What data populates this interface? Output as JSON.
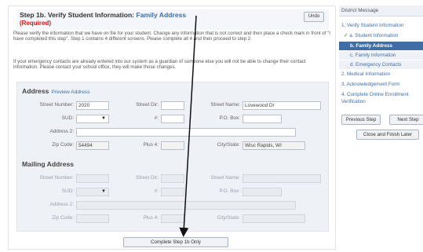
{
  "header": {
    "title_prefix": "Step 1b. Verify Student Information: ",
    "title_accent": "Family Address",
    "required": "(Required)",
    "undo_label": "Undo"
  },
  "instructions": {
    "para1": "Please verify the information that we have on file for your student. Change any information that is not correct and then place a check mark in front of \"I have completed this step\". Step 1 contains 4 different screens. Please complete all 4 and then proceed to step 2.",
    "para2": "If your emergency contacts are already entered into our system as a guardian of someone else you will not be able to change their contact information. Please contact your school office, they will make those changes."
  },
  "address": {
    "title": "Address",
    "preview_link": "Preview Address",
    "labels": {
      "street_number": "Street Number:",
      "street_dir": "Street Dir:",
      "street_name": "Street Name:",
      "sud": "SUD:",
      "hash": "#:",
      "po_box": "P.O. Box:",
      "address2": "Address 2:",
      "zip": "Zip Code:",
      "plus4": "Plus 4:",
      "city_state": "City/State:"
    },
    "values": {
      "street_number": "2020",
      "street_dir": "",
      "street_name": "Lovewood Dr",
      "sud": "",
      "hash": "",
      "po_box": "",
      "address2": "",
      "zip": "54494",
      "plus4": "",
      "city_state": "Wisc Rapids, WI"
    }
  },
  "mailing": {
    "title": "Mailing Address",
    "labels": {
      "street_number": "Street Number:",
      "street_dir": "Street Dir:",
      "street_name": "Street Name:",
      "sud": "SUD:",
      "hash": "#:",
      "po_box": "P.O. Box:",
      "address2": "Address 2:",
      "zip": "Zip Code:",
      "plus4": "Plus 4:",
      "city_state": "City/State:"
    }
  },
  "complete_button": "Complete Step 1b Only",
  "sidebar": {
    "title": "District Message",
    "items": [
      {
        "label": "1. Verify Student Information"
      },
      {
        "label": "a. Student Information"
      },
      {
        "label": "b. Family Address"
      },
      {
        "label": "c. Family Information"
      },
      {
        "label": "d. Emergency Contacts"
      },
      {
        "label": "2. Medical Information"
      },
      {
        "label": "3. Acknowledgement Form"
      },
      {
        "label": "4. Complete Online Enrollment"
      },
      {
        "label": "Verification"
      }
    ],
    "prev_button": "Previous Step",
    "next_button": "Next Step",
    "close_button": "Close and Finish Later"
  },
  "colors": {
    "accent": "#3f6ea6",
    "required": "#d61a1a",
    "check": "#6aaa3a"
  }
}
